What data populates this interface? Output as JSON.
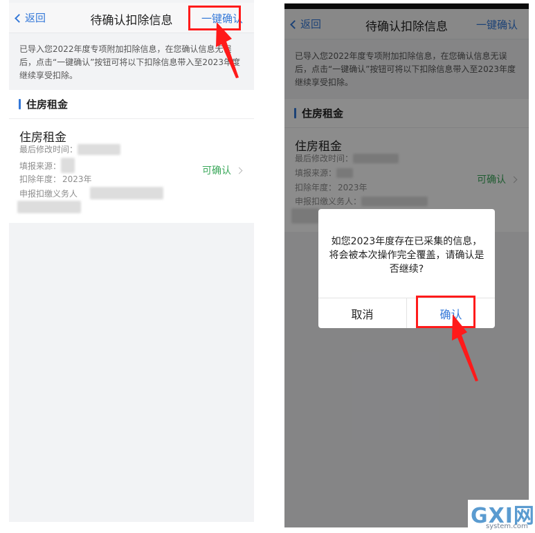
{
  "left_screen": {
    "nav": {
      "back_label": "返回",
      "title": "待确认扣除信息",
      "action_label": "一键确认"
    },
    "notice": "已导入您2022年度专项附加扣除信息，在您确认信息无误后，点击“一键确认”按钮可将以下扣除信息带入至2023年度继续享受扣除。",
    "section_title": "住房租金",
    "record": {
      "title": "住房租金",
      "last_modified_label": "最后修改时间：",
      "source_label": "填报来源：",
      "year_label": "扣除年度：",
      "year_value": "2023年",
      "agent_label": "申报扣缴义务人",
      "status": "可确认"
    }
  },
  "right_screen": {
    "nav": {
      "back_label": "返回",
      "title": "待确认扣除信息",
      "action_label": "一键确认"
    },
    "notice": "已导入您2022年度专项附加扣除信息，在您确认信息无误后，点击“一键确认”按钮可将以下扣除信息带入至2023年度继续享受扣除。",
    "section_title": "住房租金",
    "record": {
      "title": "住房租金",
      "last_modified_label": "最后修改时间：",
      "source_label": "填报来源：",
      "year_label": "扣除年度：",
      "year_value": "2023年",
      "agent_label": "申报扣缴义务人：",
      "status": "可确认"
    },
    "dialog": {
      "message": "如您2023年度存在已采集的信息，将会被本次操作完全覆盖，请确认是否继续?",
      "cancel_label": "取消",
      "confirm_label": "确认"
    }
  },
  "watermark": {
    "main": "GXI网",
    "sub": "system.com"
  },
  "colors": {
    "accent_blue": "#3478d8",
    "status_green": "#3aa85a",
    "highlight_red": "#ff1a1a"
  },
  "icons": [
    "chevron-left-icon",
    "chevron-right-icon",
    "red-arrow-icon"
  ]
}
